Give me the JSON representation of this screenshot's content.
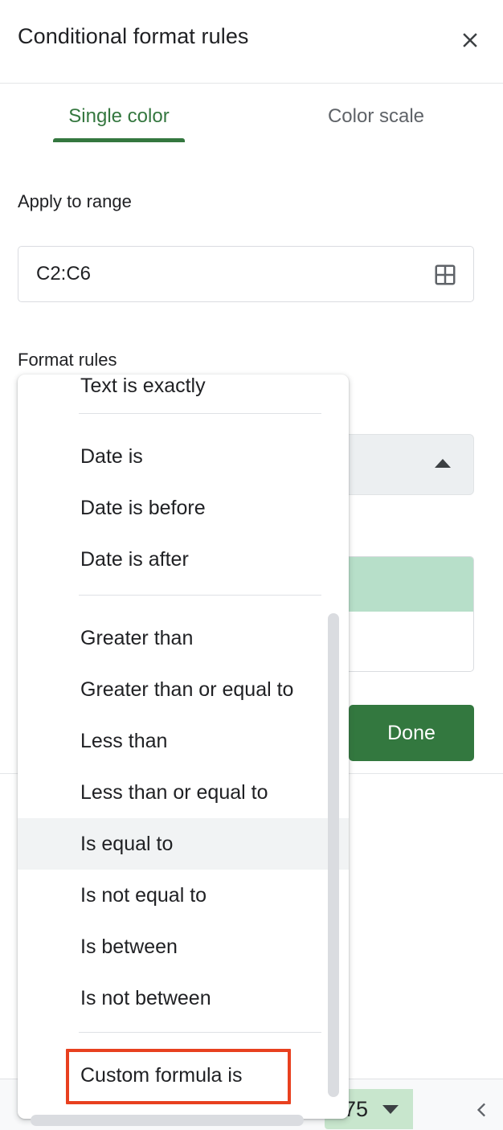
{
  "dialog": {
    "title": "Conditional format rules",
    "close_icon": "close-icon"
  },
  "tabs": [
    {
      "label": "Single color",
      "active": true
    },
    {
      "label": "Color scale",
      "active": false
    }
  ],
  "apply_to_range": {
    "label": "Apply to range",
    "value": "C2:C6",
    "placeholder": "C2:C6",
    "picker_icon": "grid-select-icon"
  },
  "format_rules": {
    "label": "Format rules",
    "select_arrow_icon": "chevron-up-icon",
    "selected_condition": "Is equal to"
  },
  "preview": {
    "fill_color": "#b7dfc9"
  },
  "buttons": {
    "done": "Done"
  },
  "dropdown": {
    "scrollbar_vertical": "vertical-scrollbar",
    "scrollbar_horizontal": "horizontal-scrollbar",
    "items": [
      {
        "label": "Text is exactly",
        "selected": false,
        "clipped": true
      },
      {
        "label": "Date is",
        "selected": false
      },
      {
        "label": "Date is before",
        "selected": false
      },
      {
        "label": "Date is after",
        "selected": false
      },
      {
        "label": "Greater than",
        "selected": false
      },
      {
        "label": "Greater than or equal to",
        "selected": false
      },
      {
        "label": "Less than",
        "selected": false
      },
      {
        "label": "Less than or equal to",
        "selected": false
      },
      {
        "label": "Is equal to",
        "selected": true
      },
      {
        "label": "Is not equal to",
        "selected": false
      },
      {
        "label": "Is between",
        "selected": false
      },
      {
        "label": "Is not between",
        "selected": false
      },
      {
        "label": "Custom formula is",
        "selected": false,
        "highlighted": true
      }
    ]
  },
  "annotation": {
    "target": "Custom formula is",
    "color": "#e8401f"
  },
  "bottom_bar": {
    "cell_value": "75",
    "cell_dropdown_icon": "chevron-down-icon",
    "prev_icon": "chevron-left-icon"
  },
  "colors": {
    "accent_green": "#34773f",
    "done_green": "#33783f",
    "preview_green": "#b7dfc9",
    "chip_green": "#c8e6cd",
    "annotation_red": "#e8401f",
    "text_primary": "#202124",
    "text_secondary": "#5f6368"
  }
}
